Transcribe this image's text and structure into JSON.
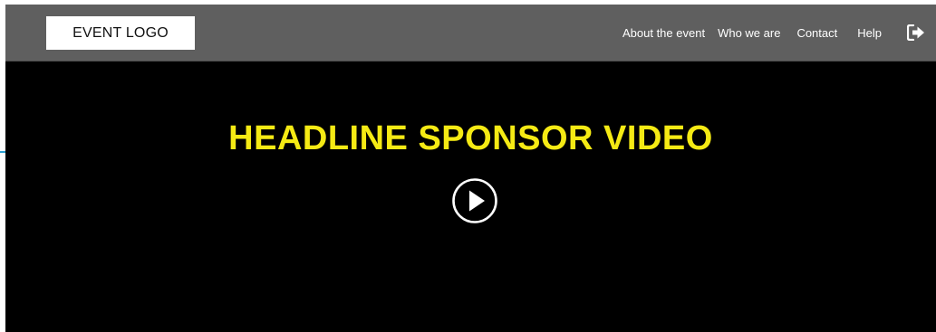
{
  "header": {
    "logo_text": "EVENT LOGO",
    "nav": [
      {
        "label": "About the event"
      },
      {
        "label": "Who we are"
      },
      {
        "label": "Contact"
      },
      {
        "label": "Help"
      }
    ],
    "logout_icon": "sign-out-icon"
  },
  "hero": {
    "headline": "HEADLINE SPONSOR VIDEO",
    "play_icon": "play-circle-icon"
  },
  "colors": {
    "header_bg": "#5f5f5f",
    "hero_bg": "#000000",
    "headline": "#f5ea14",
    "accent": "#2a9fd0"
  }
}
